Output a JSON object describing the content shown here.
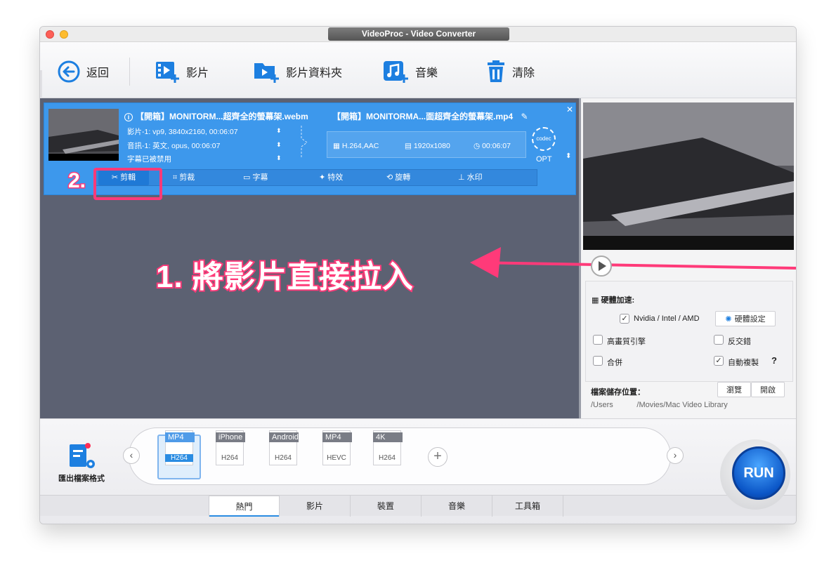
{
  "window": {
    "title": "VideoProc - Video Converter"
  },
  "toolbar": {
    "back_label": "返回",
    "video_label": "影片",
    "folder_label": "影片資料夾",
    "music_label": "音樂",
    "clear_label": "清除"
  },
  "task": {
    "source_name": "【開箱】MONITORM...超齊全的螢幕架.webm",
    "video_line": "影片-1: vp9, 3840x2160, 00:06:07",
    "audio_line": "音訊-1: 英文, opus, 00:06:07",
    "subtitle_line": "字幕已被禁用",
    "target_name": "【開箱】MONITORMA...面超齊全的螢幕架.mp4",
    "codec_text": "H.264,AAC",
    "resolution_text": "1920x1080",
    "duration_text": "00:06:07",
    "codec_badge": "codec",
    "opt_label": "OPT"
  },
  "edit_tabs": [
    "剪輯",
    "剪裁",
    "字幕",
    "特效",
    "旋轉",
    "水印"
  ],
  "annotations": {
    "step1": "1. 將影片直接拉入",
    "step2": "2."
  },
  "settings": {
    "hw_label": "硬體加速:",
    "nvidia_label": "Nvidia /  Intel / AMD",
    "hw_setting_button": "硬體設定",
    "high_quality_label": "高畫質引擎",
    "deinterlace_label": "反交錯",
    "merge_label": "合併",
    "auto_copy_label": "自動複製",
    "help_label": "?",
    "save_location_label": "檔案儲存位置：",
    "browse_button": "瀏覽",
    "open_button": "開啟",
    "save_path": "/Users           /Movies/Mac Video Library"
  },
  "formats": [
    {
      "name": "MP4",
      "sub": "H264",
      "selected": true
    },
    {
      "name": "iPhone",
      "sub": "H264",
      "selected": false
    },
    {
      "name": "Android",
      "sub": "H264",
      "selected": false
    },
    {
      "name": "MP4",
      "sub": "HEVC",
      "selected": false
    },
    {
      "name": "4K",
      "sub": "H264",
      "selected": false
    }
  ],
  "export_label": "匯出檔案格式",
  "bottom_tabs": [
    "熱門",
    "影片",
    "裝置",
    "音樂",
    "工具箱"
  ],
  "run_label": "RUN",
  "colors": {
    "accent": "#3d98ec",
    "annotation": "#ff3a79"
  }
}
